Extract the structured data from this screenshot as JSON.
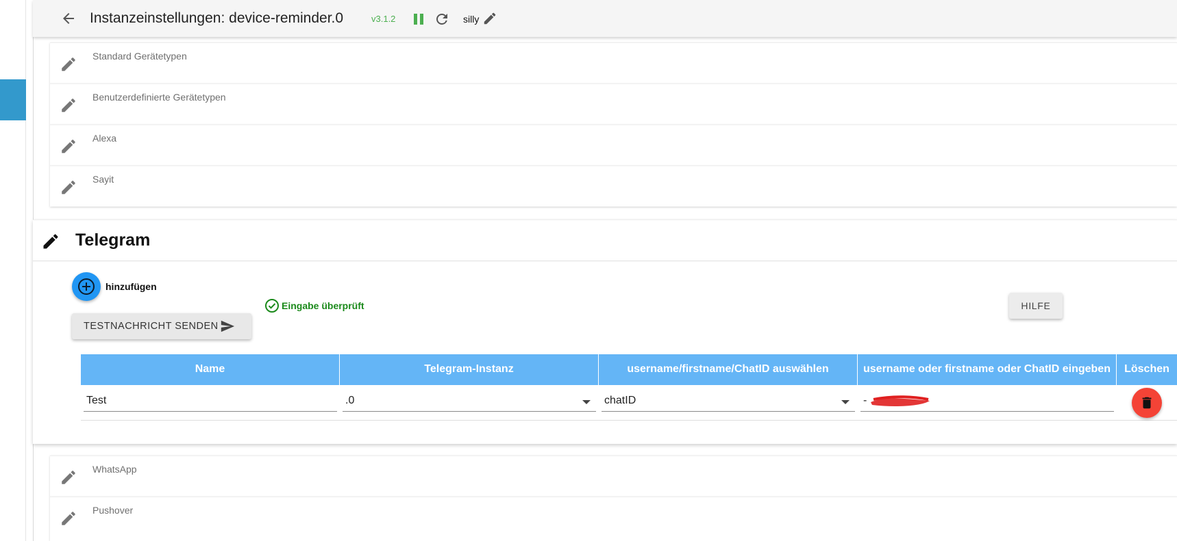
{
  "header": {
    "title": "Instanzeinstellungen: device-reminder.0",
    "version": "v3.1.2",
    "log_level": "silly"
  },
  "colors": {
    "accent": "#2196f3",
    "table_header": "#64b5f6",
    "success": "#1b8a1b",
    "version_green": "#4caf50",
    "delete_red": "#f44336",
    "sidebar_active": "#3399cc"
  },
  "sections_top": [
    {
      "label": "Standard Gerätetypen",
      "icon": "edit-icon"
    },
    {
      "label": "Benutzerdefinierte Gerätetypen",
      "icon": "edit-icon"
    },
    {
      "label": "Alexa",
      "icon": "edit-icon"
    },
    {
      "label": "Sayit",
      "icon": "edit-icon"
    }
  ],
  "telegram": {
    "title": "Telegram",
    "add_label": "hinzufügen",
    "check_label": "Eingabe überprüft",
    "test_button": "TESTNACHRICHT SENDEN",
    "help_button": "HILFE",
    "table": {
      "columns": [
        "Name",
        "Telegram-Instanz",
        "username/firstname/ChatID auswählen",
        "username oder firstname oder ChatID eingeben",
        "Löschen"
      ],
      "rows": [
        {
          "name": "Test",
          "instance": ".0",
          "selection": "chatID",
          "value": "-"
        }
      ]
    }
  },
  "sections_bottom": [
    {
      "label": "WhatsApp",
      "icon": "edit-icon"
    },
    {
      "label": "Pushover",
      "icon": "edit-icon"
    }
  ]
}
